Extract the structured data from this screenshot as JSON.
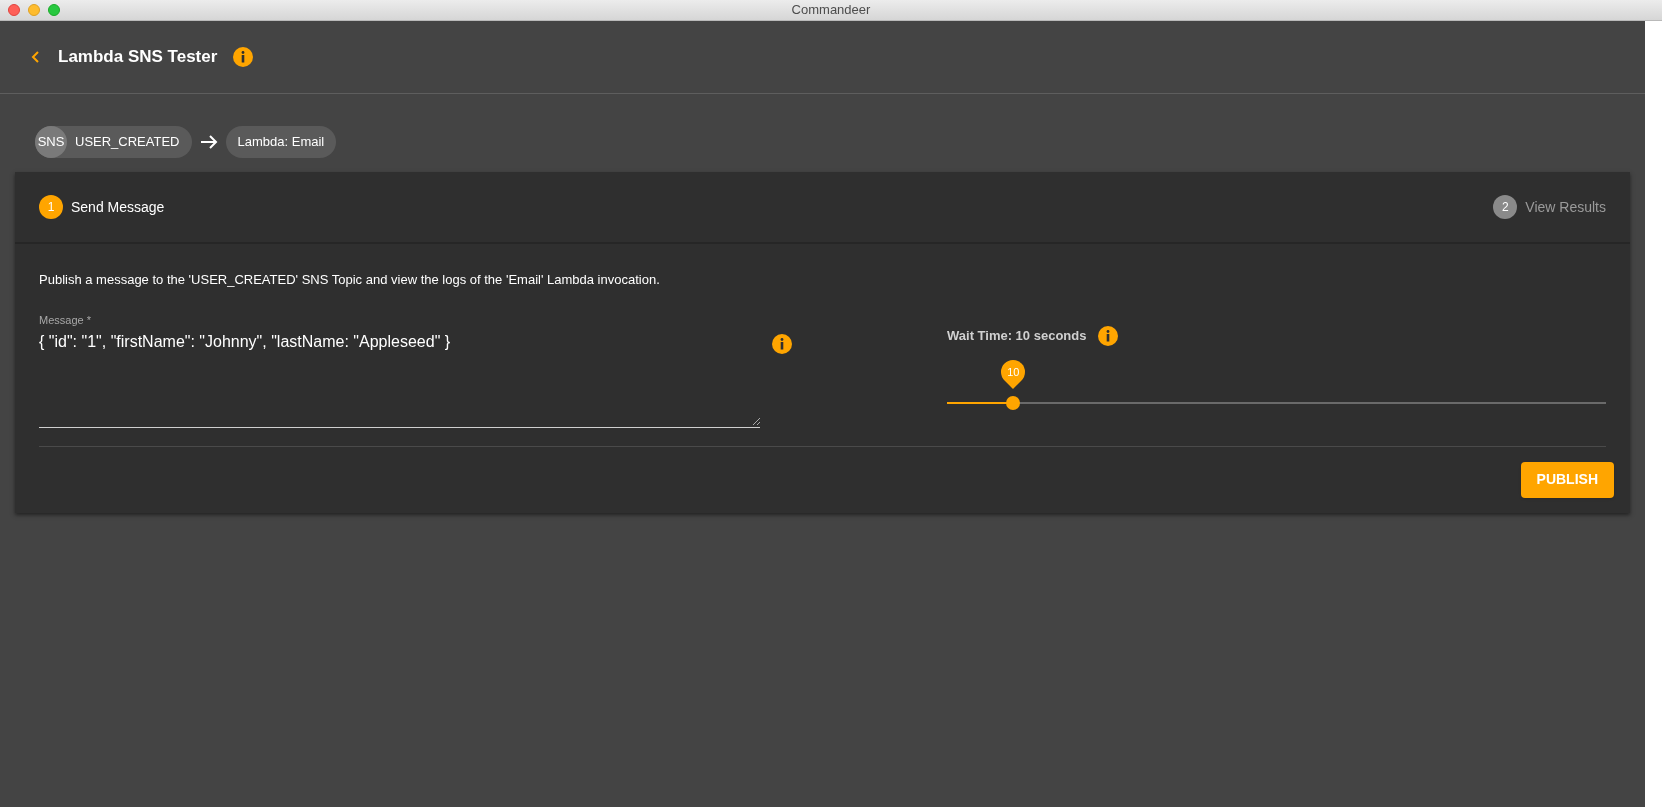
{
  "window": {
    "title": "Commandeer"
  },
  "header": {
    "title": "Lambda SNS Tester"
  },
  "flow": {
    "source_badge": "SNS",
    "source": "USER_CREATED",
    "target": "Lambda: Email"
  },
  "steps": [
    {
      "number": "1",
      "label": "Send Message",
      "selected": true
    },
    {
      "number": "2",
      "label": "View Results",
      "selected": false
    }
  ],
  "description": "Publish a message to the 'USER_CREATED' SNS Topic and view the logs of the 'Email' Lambda invocation.",
  "message": {
    "label": "Message *",
    "value": "{ \"id\": \"1\", \"firstName\": \"Johnny\", \"lastName: \"Appleseed\" }"
  },
  "wait_time": {
    "label": "Wait Time: 10 seconds",
    "reading": "10",
    "level": 0.1
  },
  "buttons": [
    "PUBLISH"
  ]
}
